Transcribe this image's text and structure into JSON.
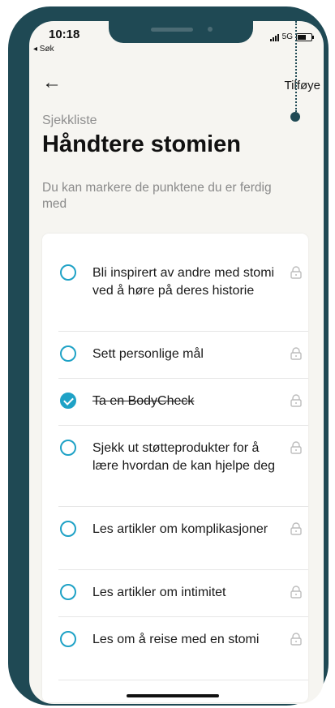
{
  "status": {
    "time": "10:18",
    "back_app": "◂ Søk",
    "network": "5G"
  },
  "header": {
    "back_icon": "arrow-left-icon",
    "add_label": "Tilføye"
  },
  "page": {
    "kicker": "Sjekkliste",
    "title": "Håndtere stomien",
    "subtitle": "Du kan markere de punktene du er ferdig med"
  },
  "checklist": [
    {
      "text": "Bli inspirert av andre med stomi ved å høre på deres historie",
      "done": false
    },
    {
      "text": "Sett personlige mål",
      "done": false
    },
    {
      "text": "Ta en BodyCheck",
      "done": true
    },
    {
      "text": "Sjekk ut støtteprodukter for å lære hvordan de kan hjelpe deg",
      "done": false
    },
    {
      "text": "Les artikler om komplikasjoner",
      "done": false
    },
    {
      "text": "Les artikler om intimitet",
      "done": false
    },
    {
      "text": "Les om å reise med en stomi",
      "done": false
    }
  ],
  "colors": {
    "accent": "#1fa2c6",
    "frame": "#1f4954",
    "background": "#f6f5f1"
  }
}
